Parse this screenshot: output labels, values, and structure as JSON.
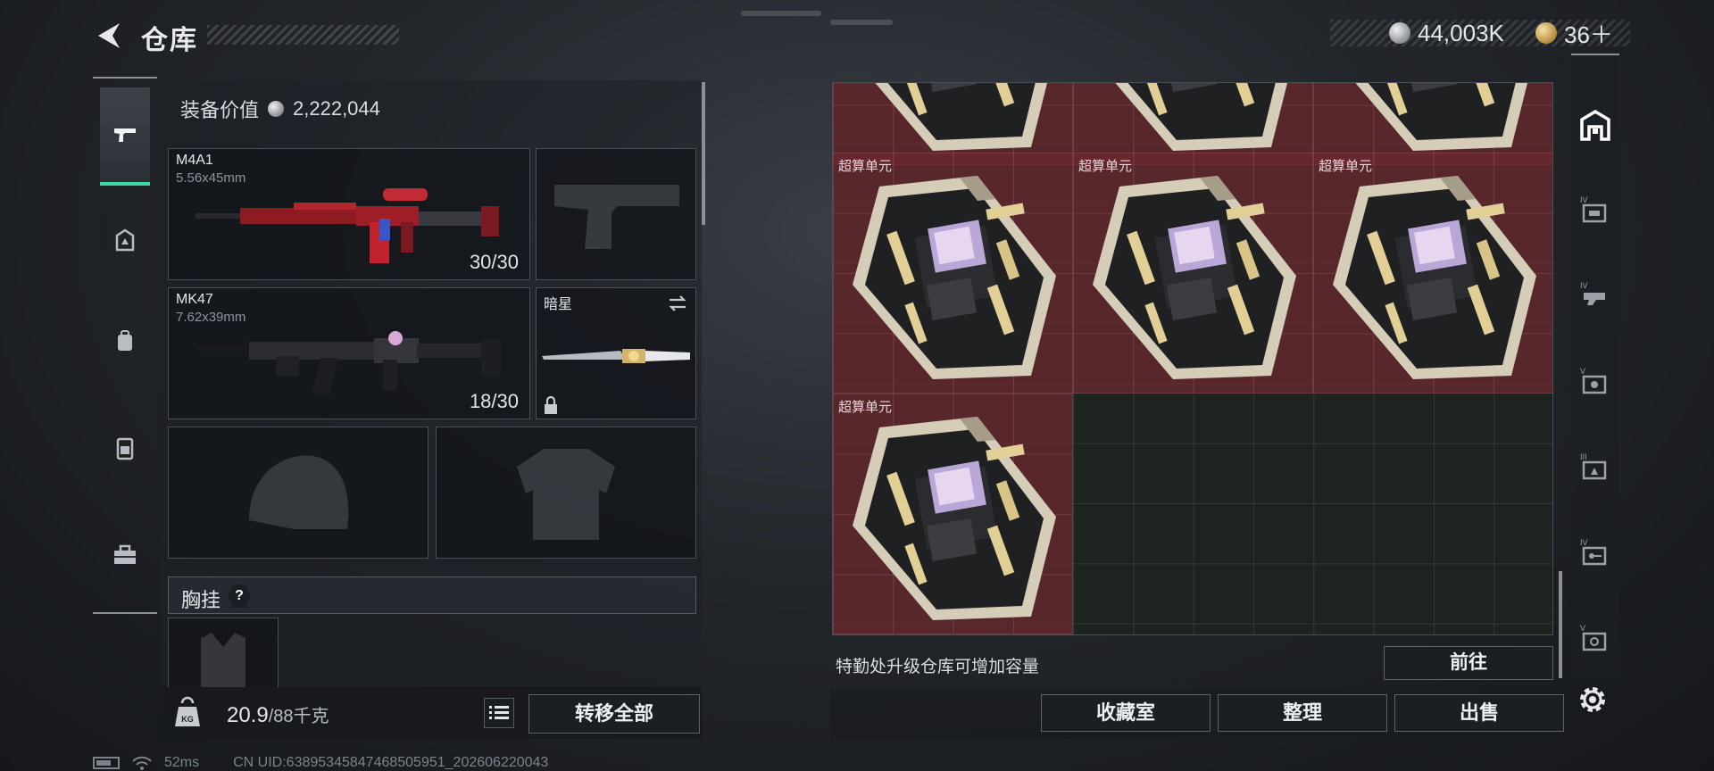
{
  "header": {
    "title": "仓库",
    "silver_amount": "44,003K",
    "gold_amount": "36＋"
  },
  "left_rail": {
    "items": [
      {
        "icon": "pistol-icon",
        "active": true
      },
      {
        "icon": "helmet-rank-icon"
      },
      {
        "icon": "backpack-icon"
      },
      {
        "icon": "vest-icon"
      },
      {
        "icon": "toolbox-icon"
      }
    ]
  },
  "equipment": {
    "value_label": "装备价值",
    "value_amount": "2,222,044",
    "primary": {
      "name": "M4A1",
      "caliber": "5.56x45mm",
      "ammo": "30/30"
    },
    "secondary": {
      "name": "MK47",
      "caliber": "7.62x39mm",
      "ammo": "18/30"
    },
    "melee": {
      "name": "暗星",
      "locked": true
    },
    "chest_rig_label": "胸挂",
    "help_mark": "?",
    "weight_value": "20.9",
    "weight_capacity": "/88千克",
    "transfer_all_label": "转移全部"
  },
  "storage": {
    "item_label": "超算单元",
    "item_count": 4,
    "capacity_hint": "特勤处升级仓库可增加容量",
    "goto_label": "前往",
    "collection_label": "收藏室",
    "sort_label": "整理",
    "sell_label": "出售"
  },
  "right_rail": {
    "items": [
      "storage-home-icon",
      "tier-4-bag-icon",
      "tier-4-rig-icon",
      "tier-5-case-icon",
      "tier-3-box-icon",
      "tier-4-key-icon",
      "tier-5-card-icon",
      "settings-gear-icon"
    ]
  },
  "status": {
    "ping": "52ms",
    "uid": "CN UID:63895345847468505951_202606220043"
  },
  "colors": {
    "accent": "#3fd6a8",
    "item_cell": "#6e2830",
    "empty_grid": "#1d2420"
  }
}
